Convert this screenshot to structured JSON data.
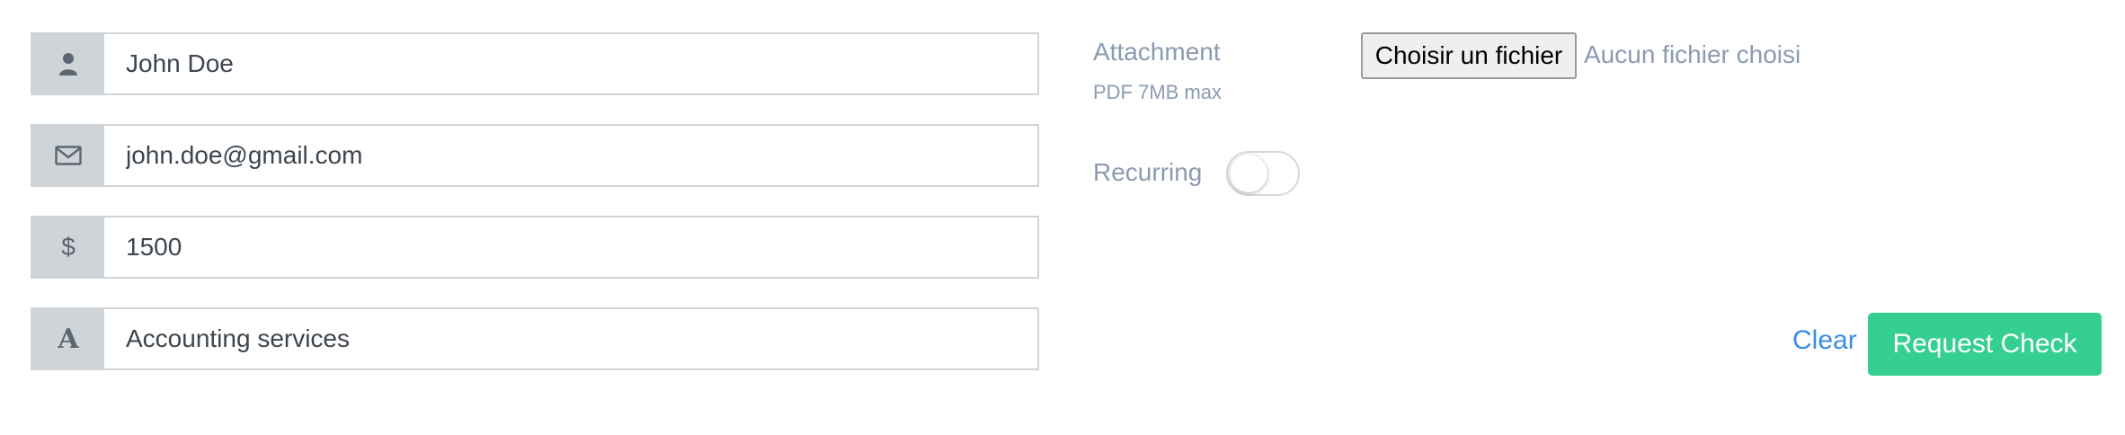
{
  "form": {
    "name": {
      "icon": "user-icon",
      "value": "John Doe"
    },
    "email": {
      "icon": "envelope-icon",
      "value": "john.doe@gmail.com"
    },
    "amount": {
      "icon": "dollar-icon",
      "icon_text": "$",
      "value": "1500"
    },
    "description": {
      "icon": "text-icon",
      "icon_text": "A",
      "value": "Accounting services"
    }
  },
  "attachment": {
    "label": "Attachment",
    "hint": "PDF 7MB max",
    "button_label": "Choisir un fichier",
    "status": "Aucun fichier choisi"
  },
  "recurring": {
    "label": "Recurring",
    "enabled": false
  },
  "actions": {
    "clear_label": "Clear",
    "submit_label": "Request Check"
  },
  "colors": {
    "accent_green": "#35d091",
    "link_blue": "#3a8de0",
    "label_gray": "#8a9bb1",
    "addon_gray": "#cfd4d9"
  }
}
